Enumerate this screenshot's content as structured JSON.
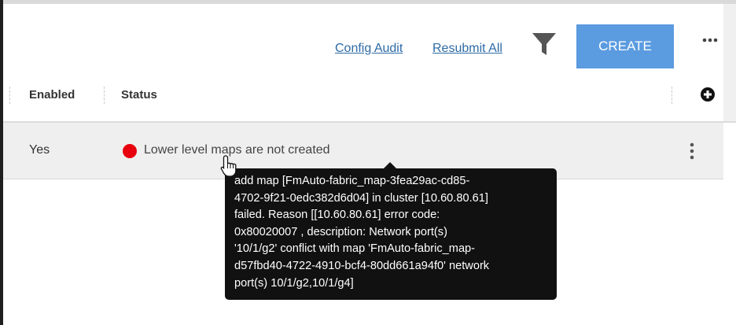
{
  "toolbar": {
    "config_audit_label": "Config Audit",
    "resubmit_all_label": "Resubmit All",
    "create_label": "CREATE",
    "filter_icon": "funnel-icon",
    "more_icon": "ellipsis-horizontal-icon"
  },
  "table": {
    "columns": [
      "Enabled",
      "Status"
    ],
    "add_column_icon": "plus-circle-icon",
    "rows": [
      {
        "enabled": "Yes",
        "status": "Lower level maps are not created",
        "status_color": "#e8000f",
        "menu_icon": "ellipsis-vertical-icon"
      }
    ]
  },
  "tooltip": {
    "lines": [
      "add map [FmAuto-fabric_map-3fea29ac-cd85-",
      "4702-9f21-0edc382d6d04] in cluster [10.60.80.61]",
      "failed. Reason [[10.60.80.61] error code:",
      "0x80020007 , description: Network port(s)",
      "'10/1/g2' conflict with map 'FmAuto-fabric_map-",
      "d57fbd40-4722-4910-bcf4-80dd661a94f0' network",
      "port(s) 10/1/g2,10/1/g4]"
    ]
  },
  "colors": {
    "accent": "#5b9be0",
    "link": "#2d6aa5",
    "row_background": "#efefef",
    "tooltip_background": "#111111"
  }
}
